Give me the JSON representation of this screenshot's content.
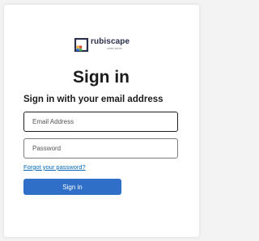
{
  "brand": {
    "name": "rubiscape",
    "tagline": "make sense"
  },
  "page": {
    "title": "Sign in",
    "subtitle": "Sign in with your email address"
  },
  "form": {
    "email_placeholder": "Email Address",
    "password_placeholder": "Password",
    "forgot_link": "Forgot your password?",
    "submit_label": "Sign in"
  },
  "colors": {
    "accent": "#2f6fc7",
    "link": "#0067b8",
    "background": "#f3f3f4"
  }
}
